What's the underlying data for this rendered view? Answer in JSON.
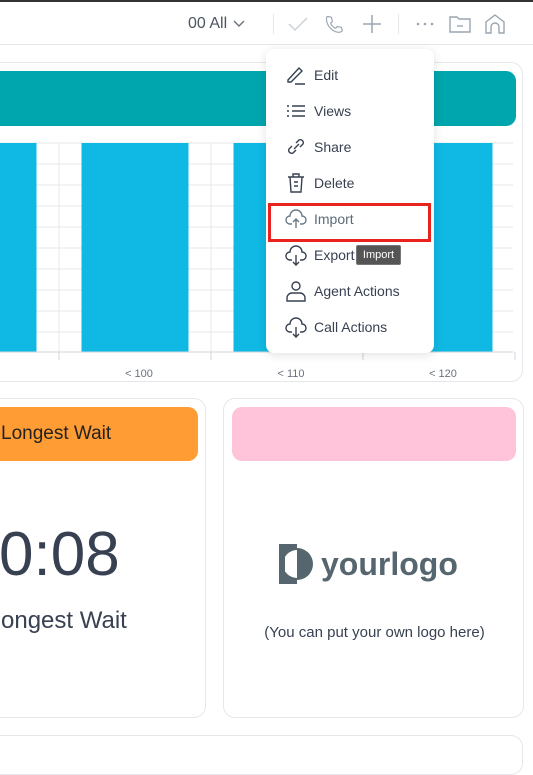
{
  "toolbar": {
    "selector_label": "00 All",
    "icons": [
      "chevron-down-icon",
      "check-icon",
      "phone-icon",
      "plus-icon",
      "more-icon",
      "folder-icon",
      "home-icon"
    ]
  },
  "menu": {
    "items": [
      {
        "label": "Edit",
        "icon": "pencil-icon"
      },
      {
        "label": "Views",
        "icon": "list-icon"
      },
      {
        "label": "Share",
        "icon": "link-icon"
      },
      {
        "label": "Delete",
        "icon": "trash-icon"
      },
      {
        "label": "Import",
        "icon": "cloud-upload-icon"
      },
      {
        "label": "Export",
        "icon": "cloud-download-icon"
      },
      {
        "label": "Agent Actions",
        "icon": "user-icon"
      },
      {
        "label": "Call Actions",
        "icon": "cloud-download-icon"
      }
    ],
    "highlighted": "Import",
    "tooltip": "Import"
  },
  "chart_data": {
    "type": "bar",
    "categories": [
      "",
      "< 100",
      "< 110",
      "< 120"
    ],
    "values": [
      1,
      1,
      1,
      1
    ],
    "grid": true,
    "color": "#0fb9e3"
  },
  "colors": {
    "chart_header": "#00a6ad",
    "wait_header": "#ff9c33",
    "logo_header": "#ffc4da",
    "highlight": "#e8221c"
  },
  "wait_card": {
    "header": "Longest Wait",
    "value": "0:08",
    "label": "ongest Wait"
  },
  "logo_card": {
    "logo_text": "yourlogo",
    "caption": "(You can put your own logo here)"
  }
}
